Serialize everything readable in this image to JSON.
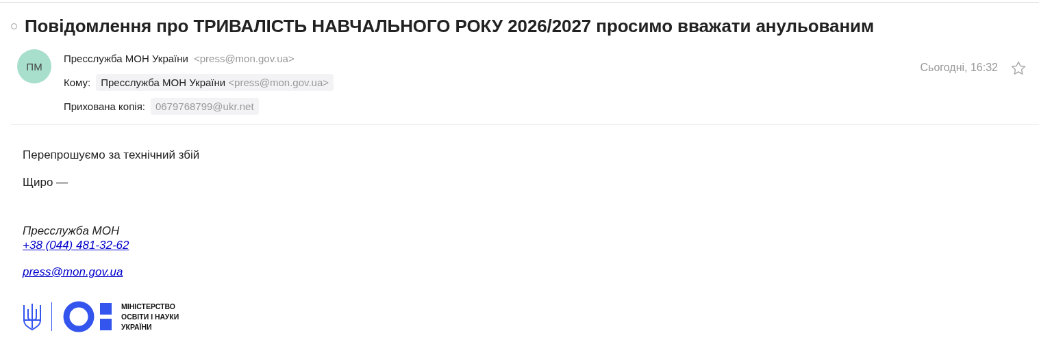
{
  "subject": "Повідомлення про ТРИВАЛІСТЬ НАВЧАЛЬНОГО РОКУ 2026/2027 просимо вважати анульованим",
  "sender": {
    "initials": "ПМ",
    "name": "Пресслужба МОН України",
    "address": "<press@mon.gov.ua>"
  },
  "to": {
    "label": "Кому:",
    "name": "Пресслужба МОН України",
    "address": "<press@mon.gov.ua>"
  },
  "bcc": {
    "label": "Прихована копія:",
    "address": "0679768799@ukr.net"
  },
  "date": "Сьогодні, 16:32",
  "starred": false,
  "body": {
    "paragraphs": [
      "Перепрошуємо за технічний збій",
      "Щиро —"
    ],
    "signature": {
      "name": "Пресслужба МОН",
      "phone": "+38 (044) 481-32-62",
      "email": "press@mon.gov.ua"
    },
    "logo_lines": [
      "МІНІСТЕРСТВО",
      "ОСВІТИ І НАУКИ",
      "УКРАЇНИ"
    ]
  }
}
